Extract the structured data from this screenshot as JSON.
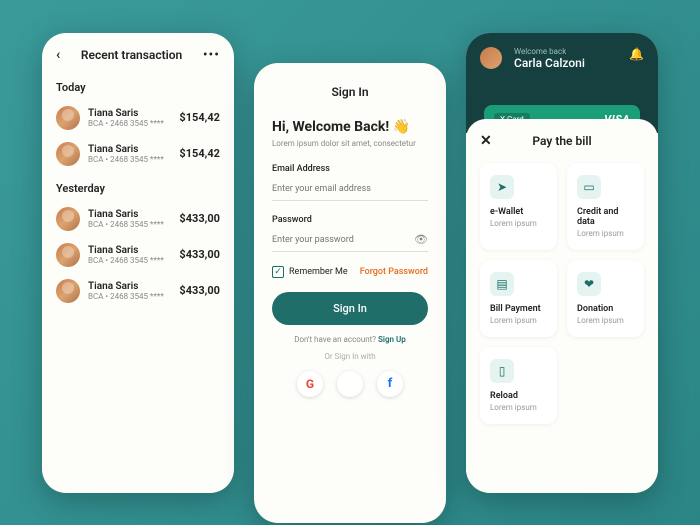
{
  "phone1": {
    "title": "Recent transaction",
    "sections": [
      {
        "label": "Today",
        "items": [
          {
            "name": "Tiana Saris",
            "sub": "BCA • 2468 3545 ****",
            "amount": "$154,42"
          },
          {
            "name": "Tiana Saris",
            "sub": "BCA • 2468 3545 ****",
            "amount": "$154,42"
          }
        ]
      },
      {
        "label": "Yesterday",
        "items": [
          {
            "name": "Tiana Saris",
            "sub": "BCA • 2468 3545 ****",
            "amount": "$433,00"
          },
          {
            "name": "Tiana Saris",
            "sub": "BCA • 2468 3545 ****",
            "amount": "$433,00"
          },
          {
            "name": "Tiana Saris",
            "sub": "BCA • 2468 3545 ****",
            "amount": "$433,00"
          }
        ]
      }
    ]
  },
  "phone2": {
    "top": "Sign In",
    "headline": "Hi, Welcome Back! 👋",
    "sub": "Lorem ipsum dolor sit amet, consectetur",
    "email_label": "Email Address",
    "email_placeholder": "Enter your email address",
    "pass_label": "Password",
    "pass_placeholder": "Enter your password",
    "remember": "Remember Me",
    "forgot": "Forgot Password",
    "button": "Sign In",
    "noacc": "Don't have an account? ",
    "signup": "Sign Up",
    "or": "Or Sign In with"
  },
  "phone3": {
    "welcome": "Welcome back",
    "user": "Carla Calzoni",
    "card": "X-Card",
    "brand": "VISA",
    "sheet_title": "Pay the bill",
    "tiles": [
      {
        "icon": "send",
        "name": "e-Wallet",
        "sub": "Lorem ipsum"
      },
      {
        "icon": "wallet",
        "name": "Credit and data",
        "sub": "Lorem ipsum"
      },
      {
        "icon": "file",
        "name": "Bill Payment",
        "sub": "Lorem ipsum"
      },
      {
        "icon": "heart",
        "name": "Donation",
        "sub": "Lorem ipsum"
      },
      {
        "icon": "phone",
        "name": "Reload",
        "sub": "Lorem ipsum"
      }
    ]
  }
}
